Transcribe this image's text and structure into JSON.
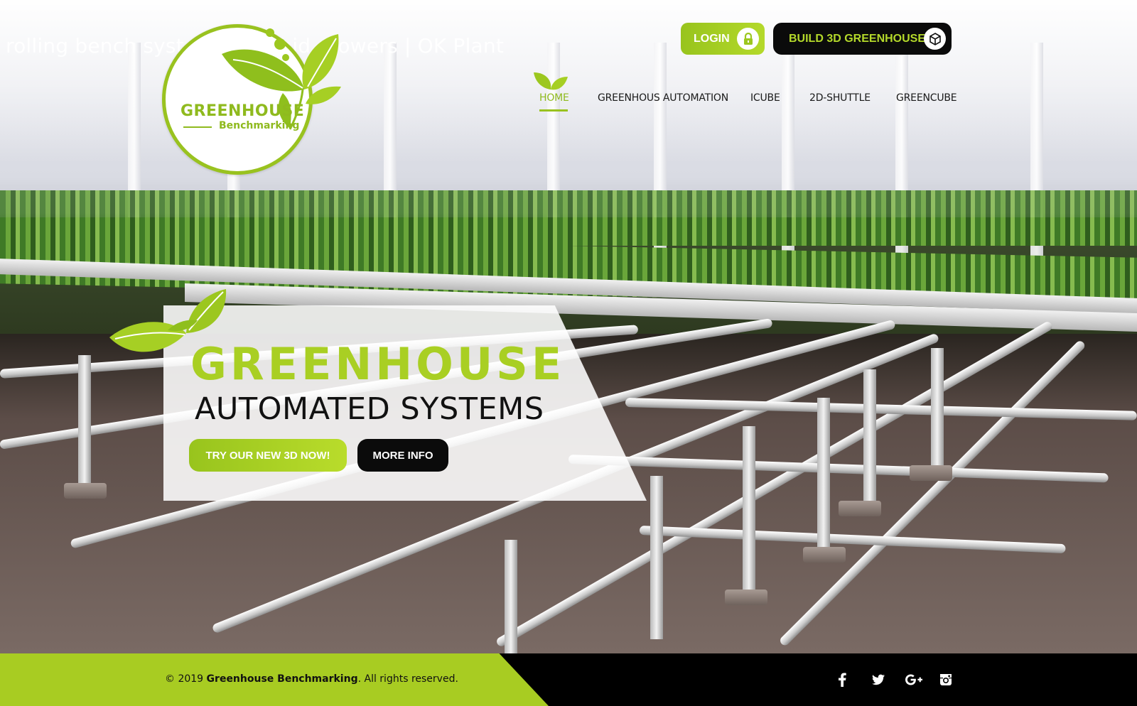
{
  "background_caption": "rolling bench system ... orchid growers | OK Plant",
  "logo": {
    "title": "GREENHOUSE",
    "subtitle": "Benchmarking",
    "icon": "leaf-logo"
  },
  "header": {
    "login_label": "LOGIN",
    "login_icon": "lock-icon",
    "build_label": "BUILD 3D GREENHOUSE",
    "build_icon": "cube-icon"
  },
  "nav": {
    "items": [
      {
        "label": "HOME",
        "active": true
      },
      {
        "label": "GREENHOUS AUTOMATION",
        "active": false
      },
      {
        "label": "ICUBE",
        "active": false
      },
      {
        "label": "2D-SHUTTLE",
        "active": false
      },
      {
        "label": "GREENCUBE",
        "active": false
      }
    ]
  },
  "hero": {
    "title": "GREENHOUSE",
    "subtitle": "AUTOMATED SYSTEMS",
    "primary_button": "TRY OUR NEW 3D NOW!",
    "secondary_button": "MORE INFO"
  },
  "footer": {
    "copyright_prefix": "© 2019",
    "company": "Greenhouse Benchmarking",
    "copyright_suffix": ". All rights reserved.",
    "social": [
      "facebook-icon",
      "twitter-icon",
      "google-plus-icon",
      "instagram-icon"
    ]
  },
  "colors": {
    "accent_green": "#a8cc22",
    "dark": "#0b0b0b",
    "white": "#ffffff"
  }
}
